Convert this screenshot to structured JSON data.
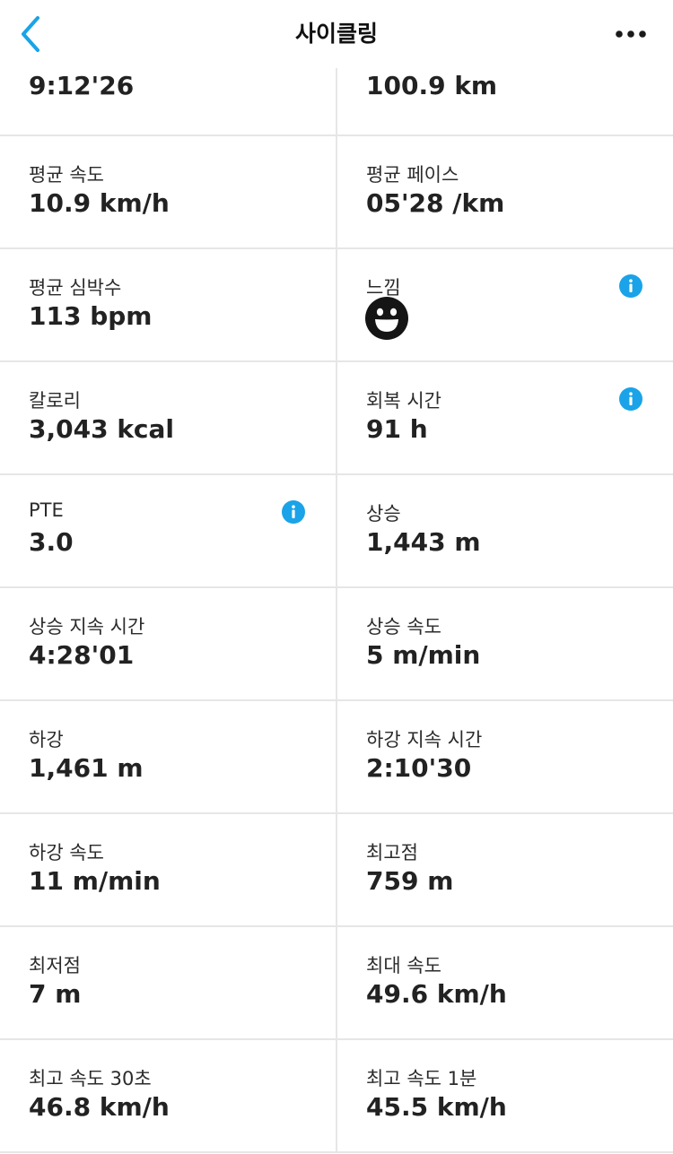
{
  "header": {
    "title": "사이클링",
    "back_icon": "chevron-left-icon",
    "more_icon": "more-dots-icon",
    "accent_color": "#1aa3e8"
  },
  "stats": [
    {
      "left": {
        "label": "",
        "value": "9:12'26"
      },
      "right": {
        "label": "",
        "value": "100.9 km"
      }
    },
    {
      "left": {
        "label": "평균 속도",
        "value": "10.9 km/h"
      },
      "right": {
        "label": "평균 페이스",
        "value": "05'28 /km"
      }
    },
    {
      "left": {
        "label": "평균 심박수",
        "value": "113 bpm"
      },
      "right": {
        "label": "느낌",
        "value": "",
        "icon": "happy-face-icon",
        "info": true
      }
    },
    {
      "left": {
        "label": "칼로리",
        "value": "3,043 kcal"
      },
      "right": {
        "label": "회복 시간",
        "value": "91 h",
        "info": true
      }
    },
    {
      "left": {
        "label": "PTE",
        "value": "3.0",
        "info": true
      },
      "right": {
        "label": "상승",
        "value": "1,443 m"
      }
    },
    {
      "left": {
        "label": "상승 지속 시간",
        "value": "4:28'01"
      },
      "right": {
        "label": "상승 속도",
        "value": "5 m/min"
      }
    },
    {
      "left": {
        "label": "하강",
        "value": "1,461 m"
      },
      "right": {
        "label": "하강 지속 시간",
        "value": "2:10'30"
      }
    },
    {
      "left": {
        "label": "하강 속도",
        "value": "11 m/min"
      },
      "right": {
        "label": "최고점",
        "value": "759 m"
      }
    },
    {
      "left": {
        "label": "최저점",
        "value": "7 m"
      },
      "right": {
        "label": "최대 속도",
        "value": "49.6 km/h"
      }
    },
    {
      "left": {
        "label": "최고 속도 30초",
        "value": "46.8 km/h"
      },
      "right": {
        "label": "최고 속도 1분",
        "value": "45.5 km/h"
      }
    }
  ]
}
